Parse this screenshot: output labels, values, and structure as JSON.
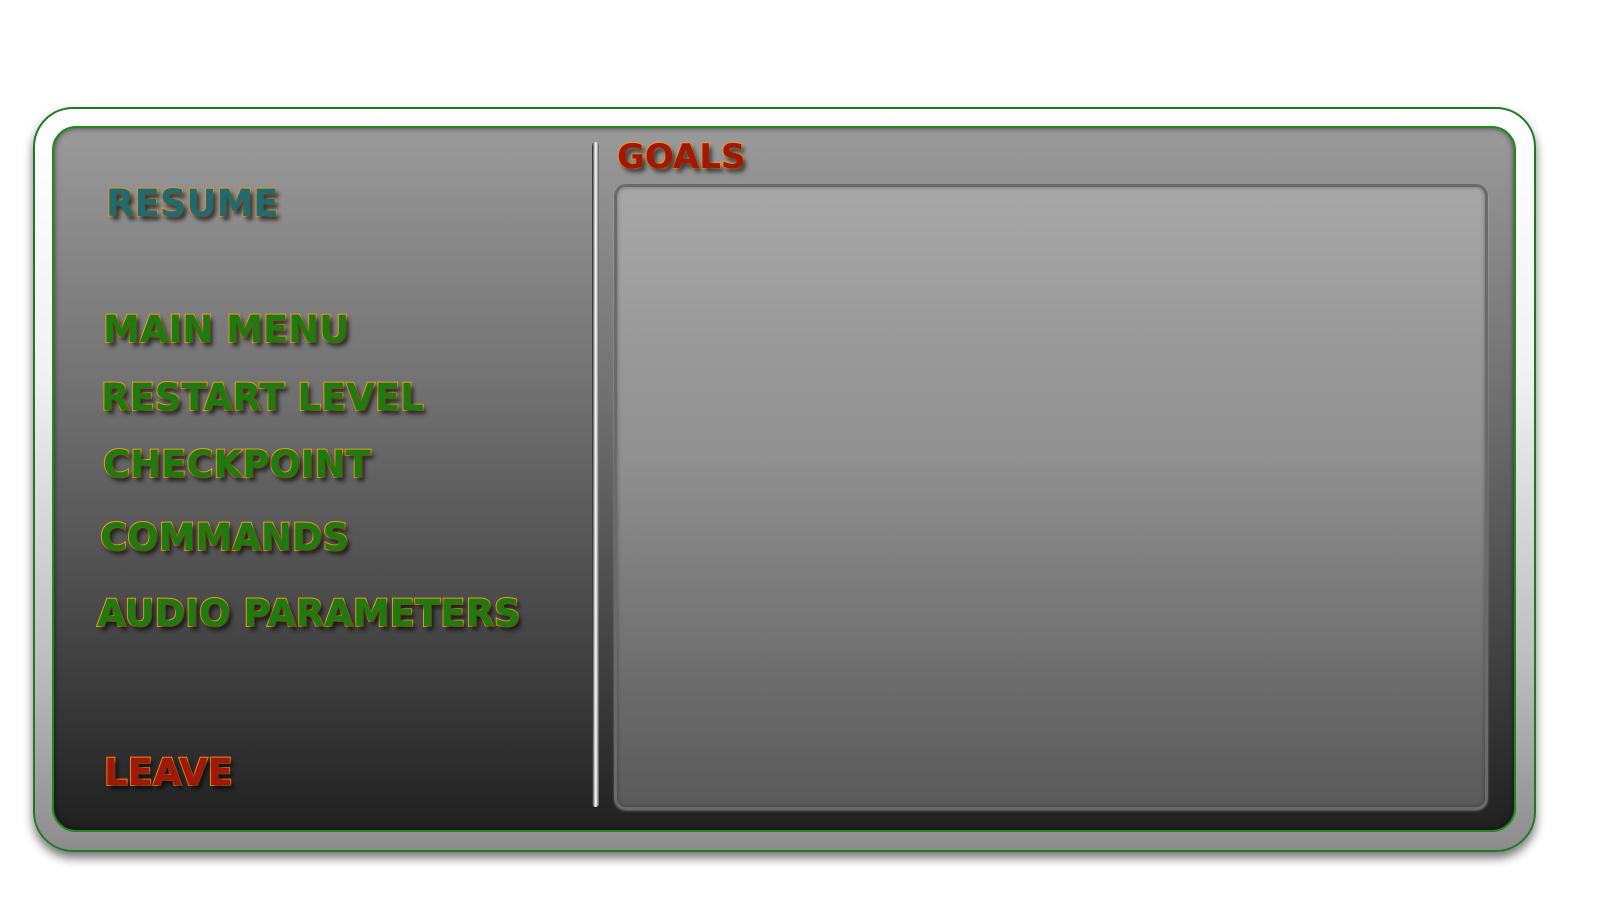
{
  "menu": {
    "resume": "RESUME",
    "main_menu": "MAIN MENU",
    "restart_level": "RESTART LEVEL",
    "checkpoint": "CHECKPOINT",
    "commands": "COMMANDS",
    "audio_parameters": "AUDIO PARAMETERS",
    "leave": "LEAVE"
  },
  "goals": {
    "title": "GOALS",
    "items": []
  },
  "colors": {
    "menu_fill": "#1f7a12",
    "resume_fill": "#1f6a73",
    "leave_fill": "#a11808",
    "outline": "#f09a18",
    "frame_border": "#1f7a1f"
  }
}
